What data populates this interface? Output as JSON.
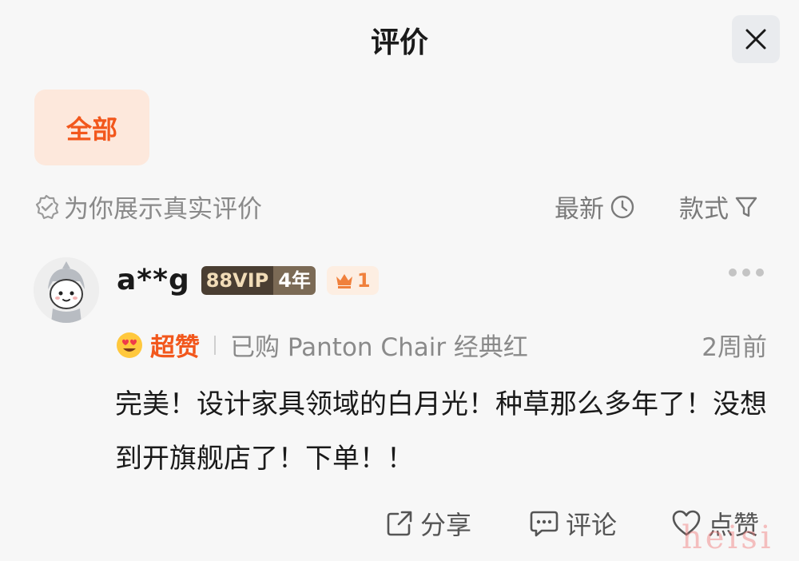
{
  "header": {
    "title": "评价",
    "close_icon": "close-icon"
  },
  "filters": {
    "all_label": "全部"
  },
  "info": {
    "notice": "为你展示真实评价",
    "sort_latest": "最新",
    "style_label": "款式"
  },
  "review": {
    "username": "a**g",
    "vip_label": "88VIP",
    "vip_years": "4年",
    "level": "1",
    "rating_label": "超赞",
    "purchase_info": "已购 Panton Chair 经典红",
    "time": "2周前",
    "text": "完美！设计家具领域的白月光！种草那么多年了！没想到开旗舰店了！下单！！"
  },
  "actions": {
    "share": "分享",
    "comment": "评论",
    "like": "点赞"
  },
  "watermark": "heisi",
  "colors": {
    "accent": "#f2571c",
    "chip_bg": "#fde8dc",
    "background": "#f7f7f7"
  }
}
